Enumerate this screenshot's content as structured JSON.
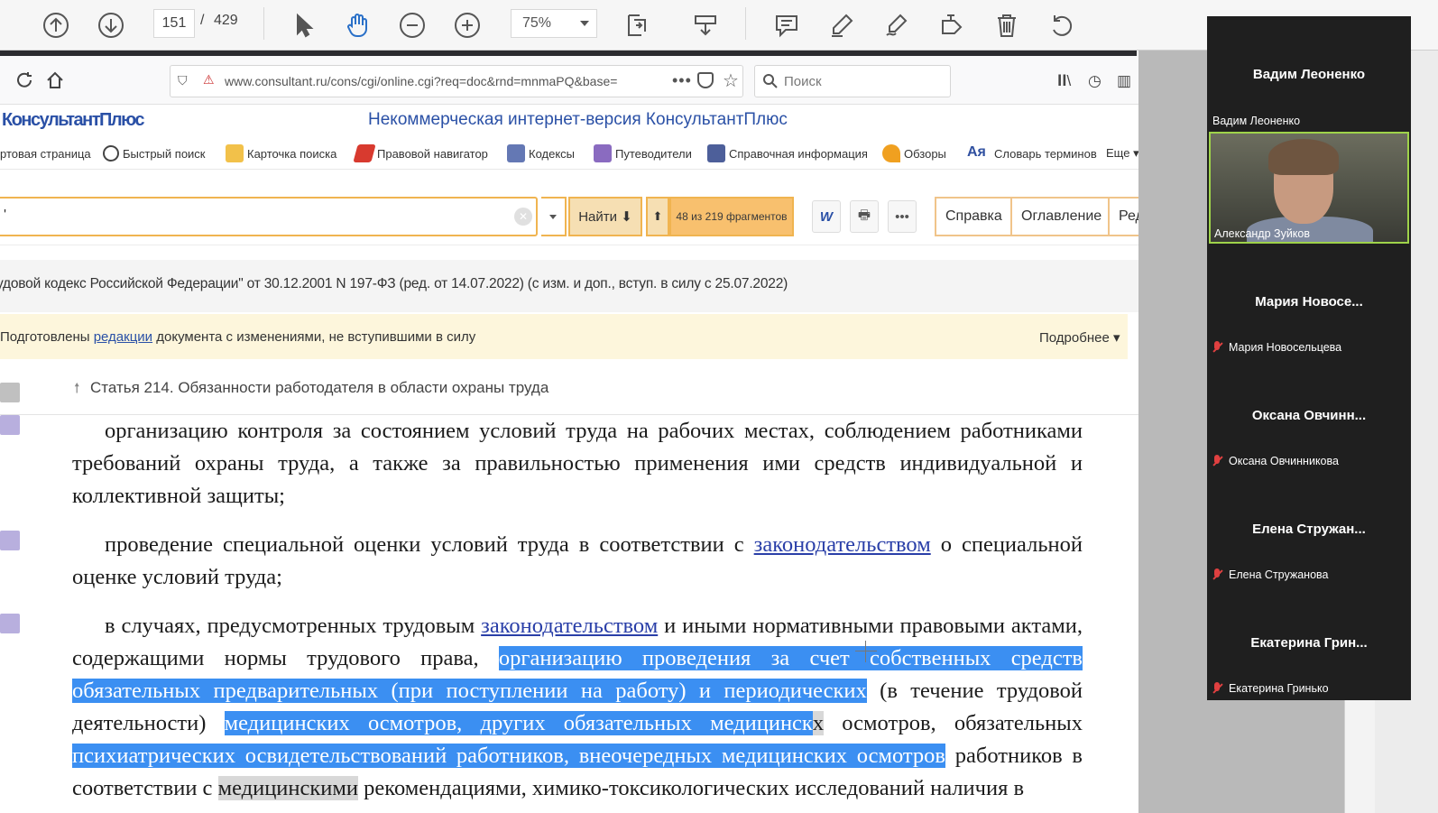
{
  "pdf_toolbar": {
    "current_page": "151",
    "separator": "/",
    "total_pages": "429",
    "zoom": "75%"
  },
  "browser": {
    "url": "www.consultant.ru/cons/cgi/online.cgi?req=doc&rnd=mnmaPQ&base=",
    "url_more": "•••",
    "search_placeholder": "Поиск"
  },
  "consultant": {
    "logo": "КонсультантПлюс",
    "title": "Некоммерческая интернет-версия КонсультантПлюс",
    "nav": [
      {
        "label": "ртовая страница",
        "icon": "none"
      },
      {
        "label": "Быстрый поиск",
        "icon": "search-icon"
      },
      {
        "label": "Карточка поиска",
        "icon": "card-search-icon"
      },
      {
        "label": "Правовой навигатор",
        "icon": "navigator-icon"
      },
      {
        "label": "Кодексы",
        "icon": "codex-icon"
      },
      {
        "label": "Путеводители",
        "icon": "guide-icon"
      },
      {
        "label": "Справочная информация",
        "icon": "reference-icon"
      },
      {
        "label": "Обзоры",
        "icon": "review-icon"
      },
      {
        "label": "Словарь терминов",
        "icon": "dictionary-icon"
      },
      {
        "label": "Еще ▾",
        "icon": "none"
      }
    ],
    "search": {
      "value": "'",
      "find_label": "Найти ⬇",
      "up_label": "⬆",
      "fragments": "48 из 219 фрагментов"
    },
    "tools": {
      "word": "W",
      "print": "🖶",
      "more": "•••"
    },
    "tabs": [
      "Справка",
      "Оглавление",
      "Ред"
    ],
    "doc_title": "удовой кодекс Российской Федерации\" от 30.12.2001 N 197-ФЗ (ред. от 14.07.2022) (с изм. и доп., вступ. в силу с 25.07.2022)",
    "notice": {
      "prefix": "Подготовлены ",
      "link": "редакции",
      "suffix": " документа с изменениями, не вступившими в силу",
      "more": "Подробнее ▾"
    },
    "article": {
      "arrow": "🠕",
      "title": "Статья 214. Обязанности работодателя в области охраны труда"
    },
    "doc": {
      "p1": "организацию контроля за состоянием условий труда на рабочих местах, соблюдением работниками требований охраны труда, а также за правильностью применения ими средств индивидуальной и коллективной защиты;",
      "p2_a": "проведение специальной оценки условий труда в соответствии с ",
      "p2_link": "законодательством",
      "p2_b": " о специальной оценке условий труда;",
      "p3_a": "в случаях, предусмотренных трудовым ",
      "p3_link": "законодательством",
      "p3_b": " и иными нормативными правовыми актами, содержащими нормы трудового права, ",
      "p3_hl1": "организацию проведения за счет собственных средств обязательных предварительных (при поступлении на работу) и периодических",
      "p3_c": " (в течение трудовой деятельности) ",
      "p3_hl2": "медицинских осмотров, других обязательных медицинск",
      "p3_grey1": "х",
      "p3_d": " осмотров, обязательных ",
      "p3_hl3": "психиатрических освидетельствований работников, внеочередных медицинских осмотров",
      "p3_e": " работников в соответствии с ",
      "p3_grey2": "медицинскими",
      "p3_f": " рекомендациями, химико-токсикологических исследований наличия в"
    }
  },
  "video_conference": {
    "tiles": [
      {
        "big": "Вадим Леоненко",
        "small": "Вадим Леоненко"
      },
      {
        "video_label": "Александр Зуйков"
      },
      {
        "big": "Мария  Новосе...",
        "small": "Мария Новосельцева"
      },
      {
        "big": "Оксана  Овчинн...",
        "small": "Оксана Овчинникова"
      },
      {
        "big": "Елена  Стружан...",
        "small": "Елена Стружанова"
      },
      {
        "big": "Екатерина  Грин...",
        "small": "Екатерина Гринько"
      }
    ]
  }
}
